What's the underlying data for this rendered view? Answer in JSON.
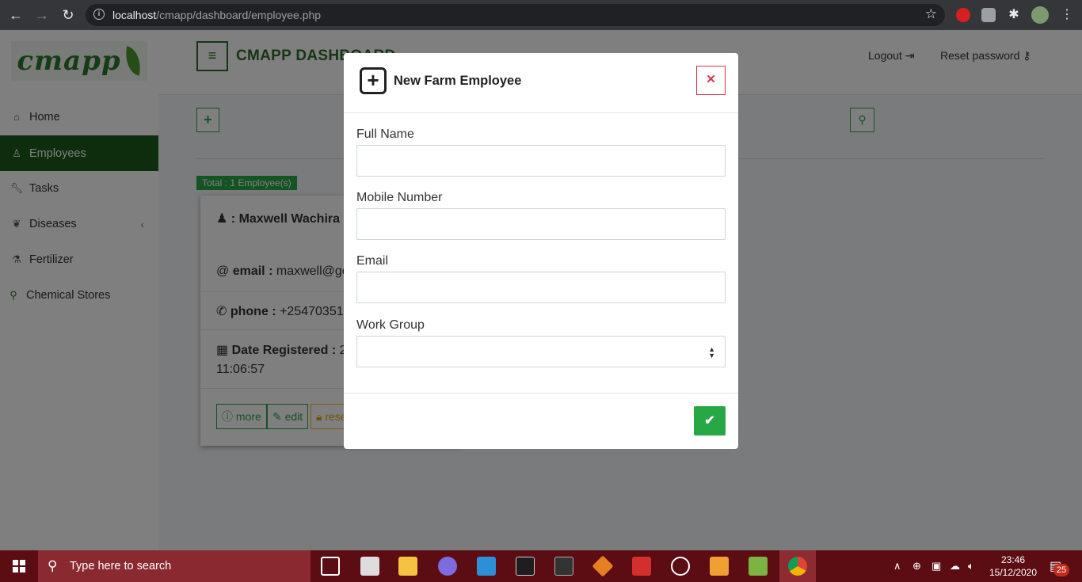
{
  "browser": {
    "url_host": "localhost",
    "url_path": "/cmapp/dashboard/employee.php"
  },
  "sidebar": {
    "logo_text": "cmapp",
    "items": [
      {
        "label": "Home",
        "icon": "home-icon"
      },
      {
        "label": "Employees",
        "icon": "user-icon"
      },
      {
        "label": "Tasks",
        "icon": "wrench-icon"
      },
      {
        "label": "Diseases",
        "icon": "leaf-icon"
      },
      {
        "label": "Fertilizer",
        "icon": "flask-icon"
      },
      {
        "label": "Chemical Stores",
        "icon": "map-marker-icon"
      }
    ]
  },
  "header": {
    "title": "CMAPP DASHBOARD",
    "logout": "Logout",
    "reset_password": "Reset password"
  },
  "content": {
    "total_badge": "Total : 1 Employee(s)",
    "card": {
      "name_label": ": Maxwell Wachira",
      "email_label": "email :",
      "email_value": "maxwell@ge",
      "phone_label": "phone :",
      "phone_value": "+25470351",
      "date_label": "Date Registered :",
      "date_value_1": "2",
      "date_value_2": "11:06:57",
      "btn_more": "more",
      "btn_edit": "edit",
      "btn_reset": "rese"
    }
  },
  "modal": {
    "title": "New Farm Employee",
    "fields": {
      "full_name": {
        "label": "Full Name",
        "value": ""
      },
      "mobile": {
        "label": "Mobile Number",
        "value": ""
      },
      "email": {
        "label": "Email",
        "value": ""
      },
      "work_group": {
        "label": "Work Group",
        "value": ""
      }
    }
  },
  "taskbar": {
    "search_placeholder": "Type here to search",
    "time": "23:46",
    "date": "15/12/2020",
    "notifications": "25"
  },
  "colors": {
    "primary_green": "#28a745",
    "dark_green": "#1d5a18",
    "danger": "#dc3545",
    "taskbar": "#5c0d14"
  }
}
